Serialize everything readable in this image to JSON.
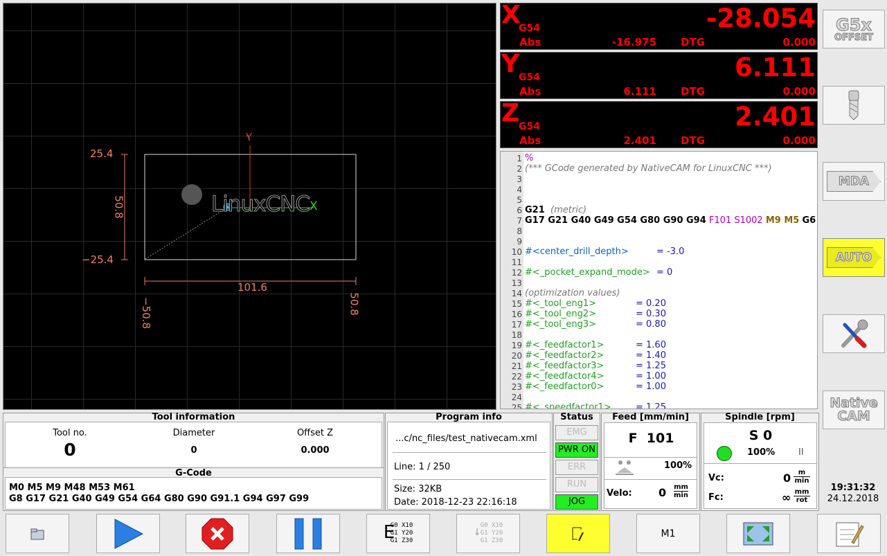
{
  "preview": {
    "dim_top": "25.4",
    "dim_bottom": "−25.4",
    "dim_height": "50.8",
    "dim_width": "101.6",
    "dim_left": "−50.8",
    "dim_right": "50.8",
    "axis_y": "Y",
    "axis_x": "X",
    "logo_text": "LinuxCNC"
  },
  "dro": [
    {
      "axis": "X",
      "g54": "G54",
      "value": "-28.054",
      "abs_label": "Abs",
      "abs_value": "-16.975",
      "dtg_label": "DTG",
      "dtg_value": "0.000"
    },
    {
      "axis": "Y",
      "g54": "G54",
      "value": "6.111",
      "abs_label": "Abs",
      "abs_value": "6.111",
      "dtg_label": "DTG",
      "dtg_value": "0.000"
    },
    {
      "axis": "Z",
      "g54": "G54",
      "value": "2.401",
      "abs_label": "Abs",
      "abs_value": "2.401",
      "dtg_label": "DTG",
      "dtg_value": "0.000"
    }
  ],
  "gcode": {
    "lines": [
      {
        "n": "1",
        "t": "%"
      },
      {
        "n": "2",
        "t": "(*** GCode generated by NativeCAM for LinuxCNC ***)"
      },
      {
        "n": "3",
        "t": ""
      },
      {
        "n": "4",
        "t": ""
      },
      {
        "n": "5",
        "t": ""
      },
      {
        "n": "6",
        "a": "G21",
        "b": "(metric)"
      },
      {
        "n": "7",
        "a": "G17 G21 G40 G49 G54 G80 G90 G94",
        "f": "F101 S1002",
        "m": "M9 M5",
        "c": "G6"
      },
      {
        "n": "8",
        "t": ""
      },
      {
        "n": "9",
        "t": ""
      },
      {
        "n": "10",
        "v": "#<center_drill_depth>",
        "val": "= -3.0",
        "style": "var"
      },
      {
        "n": "11",
        "t": ""
      },
      {
        "n": "12",
        "v": "#<_pocket_expand_mode>",
        "val": "= 0",
        "style": "var2"
      },
      {
        "n": "13",
        "t": ""
      },
      {
        "n": "14",
        "t": "(optimization values)"
      },
      {
        "n": "15",
        "v": "#<_tool_eng1>",
        "val": "= 0.20",
        "style": "var2"
      },
      {
        "n": "16",
        "v": "#<_tool_eng2>",
        "val": "= 0.30",
        "style": "var2"
      },
      {
        "n": "17",
        "v": "#<_tool_eng3>",
        "val": "= 0.80",
        "style": "var2"
      },
      {
        "n": "18",
        "t": ""
      },
      {
        "n": "19",
        "v": "#<_feedfactor1>",
        "val": "= 1.60",
        "style": "var2"
      },
      {
        "n": "20",
        "v": "#<_feedfactor2>",
        "val": "= 1.40",
        "style": "var2"
      },
      {
        "n": "21",
        "v": "#<_feedfactor3>",
        "val": "= 1.25",
        "style": "var2"
      },
      {
        "n": "22",
        "v": "#<_feedfactor4>",
        "val": "= 1.00",
        "style": "var2"
      },
      {
        "n": "23",
        "v": "#<_feedfactor0>",
        "val": "= 1.00",
        "style": "var2"
      },
      {
        "n": "24",
        "t": ""
      },
      {
        "n": "25",
        "v": "#<_speedfactor1>",
        "val": "= 1.25",
        "style": "var2"
      }
    ]
  },
  "side": {
    "g5x": [
      "G5x",
      "OFFSET"
    ],
    "mda": "MDA",
    "auto": "AUTO",
    "native": [
      "Native",
      "CAM"
    ]
  },
  "tool": {
    "title": "Tool information",
    "no_label": "Tool no.",
    "no_value": "0",
    "dia_label": "Diameter",
    "dia_value": "0",
    "offz_label": "Offset Z",
    "offz_value": "0.000"
  },
  "gcodebox": {
    "title": "G-Code",
    "mcodes": "M0 M5 M9 M48 M53 M61",
    "gcodes": "G8 G17 G21 G40 G49 G54 G64 G80 G90 G91.1 G94 G97 G99"
  },
  "program": {
    "title": "Program info",
    "file": "...c/nc_files/test_nativecam.xml",
    "line": "Line: 1 / 250",
    "size": "Size: 32KB",
    "date": "Date: 2018-12-23 22:16:18"
  },
  "status": {
    "title": "Status",
    "leds": [
      {
        "label": "EMG",
        "on": false
      },
      {
        "label": "PWR ON",
        "on": true
      },
      {
        "label": "ERR",
        "on": false
      },
      {
        "label": "RUN",
        "on": false
      },
      {
        "label": "JOG",
        "on": true
      }
    ]
  },
  "feed": {
    "title": "Feed [mm/min]",
    "value": "F  101",
    "override": "100%",
    "velo_label": "Velo:",
    "velo_value": "0",
    "velo_unit_top": "mm",
    "velo_unit_bot": "min"
  },
  "spindle": {
    "title": "Spindle [rpm]",
    "value": "S 0",
    "override": "100%",
    "pause_glyph": "II",
    "vc_label": "Vc:",
    "vc_value": "0",
    "vc_unit_top": "m",
    "vc_unit_bot": "min",
    "fc_label": "Fc:",
    "fc_value": "∞",
    "fc_unit_top": "mm",
    "fc_unit_bot": "rot"
  },
  "clock": {
    "time": "19:31:32",
    "date": "24.12.2018"
  },
  "toolbar": {
    "step_lines": [
      "G0 X10",
      "G1 Y20",
      "G1 Z30"
    ],
    "m1_label": "M1"
  },
  "colors": {
    "accent_yellow": "#ffff30",
    "led_green": "#22ee22",
    "dro_red": "#ff0000"
  }
}
